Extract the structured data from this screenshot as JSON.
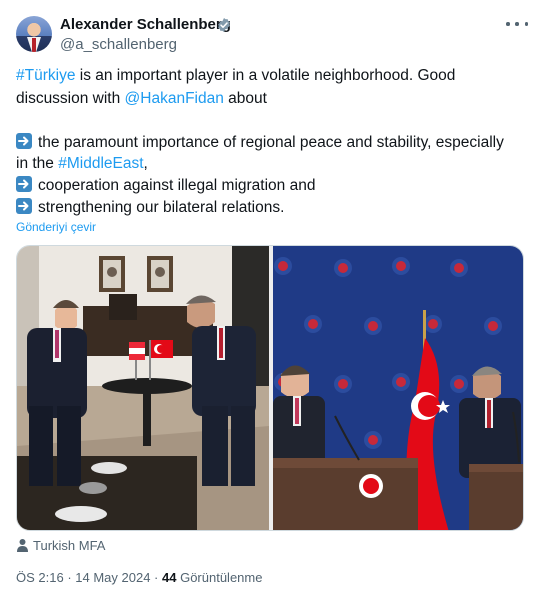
{
  "author": {
    "name": "Alexander Schallenberg",
    "handle": "@a_schallenberg",
    "verified_color": "#829aab"
  },
  "tweet": {
    "line1_link": "#Türkiye",
    "line1_rest": " is an important player in a volatile neighborhood. Good",
    "line2_start": "discussion with ",
    "line2_link": "@HakanFidan",
    "line2_end": " about",
    "bullet1_start": "the paramount importance of regional peace and stability, especially",
    "bullet1_cont_start": "in the ",
    "bullet1_cont_link": "#MiddleEast",
    "bullet1_cont_end": ",",
    "bullet2": "cooperation against illegal migration and",
    "bullet3": "strengthening our bilateral relations."
  },
  "translate_label": "Gönderiyi çevir",
  "media": {
    "credit": "Turkish MFA"
  },
  "meta": {
    "time": "ÖS 2:16",
    "sep1": " · ",
    "date": "14 May 2024",
    "sep2": " · ",
    "views_count": "44",
    "views_label": " Görüntülenme"
  },
  "colors": {
    "link": "#1d9bf0",
    "muted": "#536471",
    "arrow_emoji": "#3b88c3",
    "flag_red": "#e30a17"
  },
  "icons": [
    "verified-badge-icon",
    "more-options-icon",
    "arrow-right-emoji-icon",
    "person-icon"
  ]
}
